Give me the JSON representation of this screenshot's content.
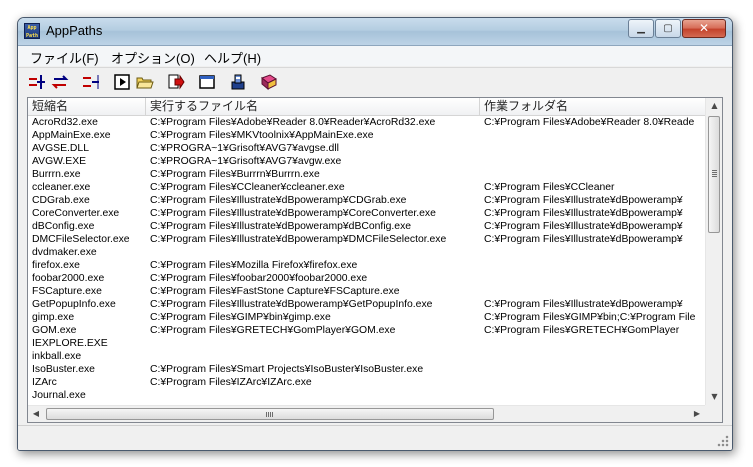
{
  "window": {
    "title": "AppPaths",
    "icon_text": "App Path",
    "minimize_glyph": "▁",
    "maximize_glyph": "▢",
    "close_glyph": "✕"
  },
  "menu": {
    "file": "ファイル(F)",
    "options": "オプション(O)",
    "help": "ヘルプ(H)"
  },
  "toolbar": {
    "buttons": [
      {
        "icon": "add-entry-icon"
      },
      {
        "icon": "swap-entries-icon"
      },
      {
        "icon": "delete-entry-icon"
      },
      {
        "icon": "run-icon"
      },
      {
        "icon": "open-folder-icon"
      },
      {
        "icon": "export-icon"
      },
      {
        "icon": "window-icon"
      },
      {
        "icon": "install-icon"
      },
      {
        "icon": "book-icon"
      }
    ]
  },
  "table": {
    "columns": [
      "短縮名",
      "実行するファイル名",
      "作業フォルダ名"
    ],
    "rows": [
      [
        "AcroRd32.exe",
        "C:¥Program Files¥Adobe¥Reader 8.0¥Reader¥AcroRd32.exe",
        "C:¥Program Files¥Adobe¥Reader 8.0¥Reade"
      ],
      [
        "AppMainExe.exe",
        "C:¥Program Files¥MKVtoolnix¥AppMainExe.exe",
        ""
      ],
      [
        "AVGSE.DLL",
        "C:¥PROGRA~1¥Grisoft¥AVG7¥avgse.dll",
        ""
      ],
      [
        "AVGW.EXE",
        "C:¥PROGRA~1¥Grisoft¥AVG7¥avgw.exe",
        ""
      ],
      [
        "Burrrn.exe",
        "C:¥Program Files¥Burrrn¥Burrrn.exe",
        ""
      ],
      [
        "ccleaner.exe",
        "C:¥Program Files¥CCleaner¥ccleaner.exe",
        "C:¥Program Files¥CCleaner"
      ],
      [
        "CDGrab.exe",
        "C:¥Program Files¥Illustrate¥dBpoweramp¥CDGrab.exe",
        "C:¥Program Files¥Illustrate¥dBpoweramp¥"
      ],
      [
        "CoreConverter.exe",
        "C:¥Program Files¥Illustrate¥dBpoweramp¥CoreConverter.exe",
        "C:¥Program Files¥Illustrate¥dBpoweramp¥"
      ],
      [
        "dBConfig.exe",
        "C:¥Program Files¥Illustrate¥dBpoweramp¥dBConfig.exe",
        "C:¥Program Files¥Illustrate¥dBpoweramp¥"
      ],
      [
        "DMCFileSelector.exe",
        "C:¥Program Files¥Illustrate¥dBpoweramp¥DMCFileSelector.exe",
        "C:¥Program Files¥Illustrate¥dBpoweramp¥"
      ],
      [
        "dvdmaker.exe",
        "",
        ""
      ],
      [
        "firefox.exe",
        "C:¥Program Files¥Mozilla Firefox¥firefox.exe",
        ""
      ],
      [
        "foobar2000.exe",
        "C:¥Program Files¥foobar2000¥foobar2000.exe",
        ""
      ],
      [
        "FSCapture.exe",
        "C:¥Program Files¥FastStone Capture¥FSCapture.exe",
        ""
      ],
      [
        "GetPopupInfo.exe",
        "C:¥Program Files¥Illustrate¥dBpoweramp¥GetPopupInfo.exe",
        "C:¥Program Files¥Illustrate¥dBpoweramp¥"
      ],
      [
        "gimp.exe",
        "C:¥Program Files¥GIMP¥bin¥gimp.exe",
        "C:¥Program Files¥GIMP¥bin;C:¥Program File"
      ],
      [
        "GOM.exe",
        "C:¥Program Files¥GRETECH¥GomPlayer¥GOM.exe",
        "C:¥Program Files¥GRETECH¥GomPlayer"
      ],
      [
        "IEXPLORE.EXE",
        "",
        ""
      ],
      [
        "inkball.exe",
        "",
        ""
      ],
      [
        "IsoBuster.exe",
        "C:¥Program Files¥Smart Projects¥IsoBuster¥IsoBuster.exe",
        ""
      ],
      [
        "IZArc",
        "C:¥Program Files¥IZArc¥IZArc.exe",
        ""
      ],
      [
        "Journal.exe",
        "",
        ""
      ]
    ]
  },
  "scrollbar": {
    "up_arrow": "▲",
    "down_arrow": "▼",
    "left_arrow": "◀",
    "right_arrow": "▶"
  },
  "colors": {
    "title_gradient": "#b4cde1",
    "close_button": "#c2402a",
    "list_background": "#ffffff"
  }
}
